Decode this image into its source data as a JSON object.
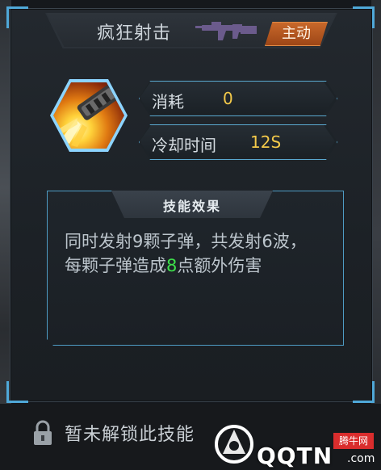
{
  "skill": {
    "name": "疯狂射击",
    "type_tag": "主动",
    "icon": "muzzle-flash-icon",
    "weapon_icon": "machine-gun-icon"
  },
  "stats": [
    {
      "label": "消耗",
      "value": "0"
    },
    {
      "label": "冷却时间",
      "value": "12S"
    }
  ],
  "effect": {
    "title": "技能效果",
    "text_before": "同时发射9颗子弹，共发射6波，每颗子弹造成",
    "highlight": "8",
    "text_after": "点额外伤害"
  },
  "lock": {
    "icon": "lock-icon",
    "text": "暂未解锁此技能"
  },
  "watermark": {
    "brand": "QQTN",
    "suffix": ".com",
    "badge": "腾牛网"
  },
  "colors": {
    "accent": "#4fa8d8",
    "value_gold": "#f3c94a",
    "highlight_green": "#3ee04b",
    "tag_orange": "#c8682a"
  }
}
